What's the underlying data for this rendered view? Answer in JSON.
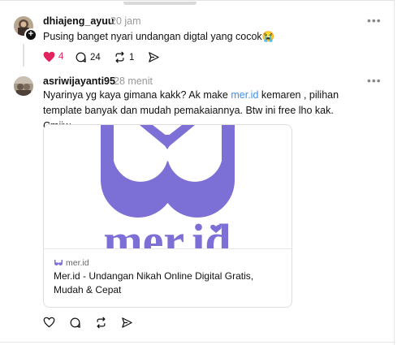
{
  "posts": [
    {
      "username": "dhiajeng_ayuu",
      "time": "20 jam",
      "text": "Pusing banget nyari undangan digtal yang cocok😭",
      "likes": "4",
      "comments": "24",
      "reposts": "1"
    },
    {
      "username": "asriwijayanti95",
      "time": "28 menit",
      "text_before": "Nyarinya yg kaya gimana kakk? Ak make ",
      "link_text": "mer.id",
      "text_after": " kemaren , pilihan template banyak dan mudah pemakaiannya. Btw ini free lho kak. Cmiiw",
      "card": {
        "logo_text": "mer.id",
        "domain": "mer.id",
        "title": "Mer.id - Undangan Nikah Online Digital Gratis, Mudah & Cepat"
      }
    }
  ],
  "colors": {
    "accent": "#7c6fd6",
    "link": "#3d8ef0",
    "like": "#e0245e"
  },
  "icons": [
    "heart-icon",
    "comment-icon",
    "repost-icon",
    "share-icon",
    "more-icon",
    "follow-plus-icon"
  ]
}
